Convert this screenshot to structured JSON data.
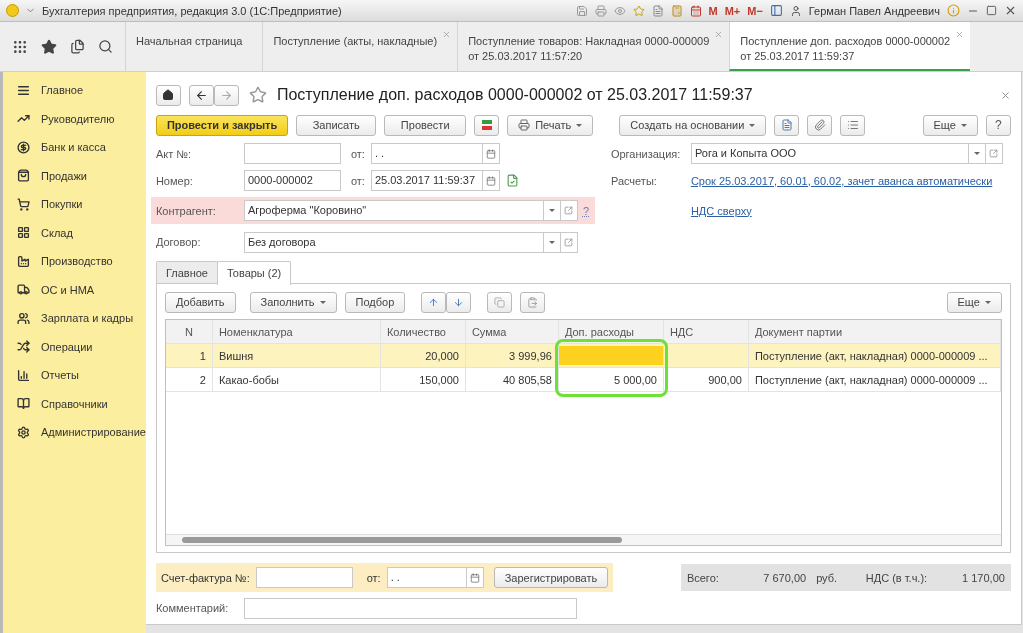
{
  "window": {
    "title": "Бухгалтерия предприятия, редакция 3.0  (1С:Предприятие)",
    "memory_buttons": [
      "M",
      "M+",
      "M−"
    ],
    "user": "Герман Павел Андреевич"
  },
  "open_tabs": [
    {
      "lines": [
        "Начальная страница"
      ],
      "selected": false,
      "closable": false
    },
    {
      "lines": [
        "Поступление (акты, накладные)"
      ],
      "selected": false,
      "closable": true
    },
    {
      "lines": [
        "Поступление товаров: Накладная 0000-000009",
        "от 25.03.2017 11:57:20"
      ],
      "selected": false,
      "closable": true
    },
    {
      "lines": [
        "Поступление доп. расходов 0000-000002",
        "от 25.03.2017 11:59:37"
      ],
      "selected": true,
      "closable": true
    }
  ],
  "sidebar": {
    "items": [
      {
        "label": "Главное"
      },
      {
        "label": "Руководителю"
      },
      {
        "label": "Банк и касса"
      },
      {
        "label": "Продажи"
      },
      {
        "label": "Покупки"
      },
      {
        "label": "Склад"
      },
      {
        "label": "Производство"
      },
      {
        "label": "ОС и НМА"
      },
      {
        "label": "Зарплата и кадры"
      },
      {
        "label": "Операции"
      },
      {
        "label": "Отчеты"
      },
      {
        "label": "Справочники"
      },
      {
        "label": "Администрирование"
      }
    ]
  },
  "form": {
    "title": "Поступление доп. расходов 0000-000002 от 25.03.2017 11:59:37",
    "toolbar": {
      "primary": "Провести и закрыть",
      "buttons": [
        "Записать",
        "Провести"
      ],
      "print": "Печать",
      "create_based": "Создать на основании",
      "more": "Еще",
      "help": "?"
    },
    "act_number": {
      "label": "Акт №:",
      "date_label": "от:",
      "date_value": ".  ."
    },
    "number": {
      "label": "Номер:",
      "value": "0000-000002",
      "date_label": "от:",
      "date_value": "25.03.2017 11:59:37"
    },
    "counterparty": {
      "label": "Контрагент:",
      "value": "Агроферма \"Коровино\"",
      "required": true,
      "hint": "?"
    },
    "contract": {
      "label": "Договор:",
      "value": "Без договора"
    },
    "organization": {
      "label": "Организация:",
      "value": "Рога и Копыта ООО"
    },
    "settlements": {
      "label": "Расчеты:",
      "link": "Срок 25.03.2017, 60.01, 60.02, зачет аванса автоматически"
    },
    "vat_link": "НДС сверху",
    "tabs": [
      {
        "label": "Главное",
        "selected": false
      },
      {
        "label": "Товары (2)",
        "selected": true
      }
    ],
    "table_toolbar": {
      "add": "Добавить",
      "fill": "Заполнить",
      "pick": "Подбор",
      "more": "Еще"
    },
    "table": {
      "columns": [
        {
          "label": "N",
          "highlighted": false
        },
        {
          "label": "Номенклатура",
          "highlighted": false
        },
        {
          "label": "Количество",
          "highlighted": false
        },
        {
          "label": "Сумма",
          "highlighted": false
        },
        {
          "label": "Доп. расходы",
          "highlighted": true
        },
        {
          "label": "НДС",
          "highlighted": false
        },
        {
          "label": "Документ партии",
          "highlighted": false
        }
      ],
      "rows": [
        {
          "n": "1",
          "name": "Вишня",
          "qty": "20,000",
          "sum": "3 999,96",
          "doc": "Поступление (акт, накладная) 0000-000009 ...",
          "selected": true,
          "editing": true
        },
        {
          "n": "2",
          "name": "Какао-бобы",
          "qty": "150,000",
          "sum": "40 805,58",
          "extra": "5 000,00",
          "vat": "900,00",
          "doc": "Поступление (акт, накладная) 0000-000009 ...",
          "selected": false,
          "editing": false
        }
      ]
    },
    "invoice": {
      "label": "Счет-фактура №:",
      "date_label": "от:",
      "date_value": ".  .",
      "register": "Зарегистрировать"
    },
    "totals": {
      "total_label": "Всего:",
      "total": "7 670,00",
      "currency": "руб.",
      "vat_label": "НДС (в т.ч.):",
      "vat": "1 170,00"
    },
    "comment": {
      "label": "Комментарий:"
    }
  }
}
